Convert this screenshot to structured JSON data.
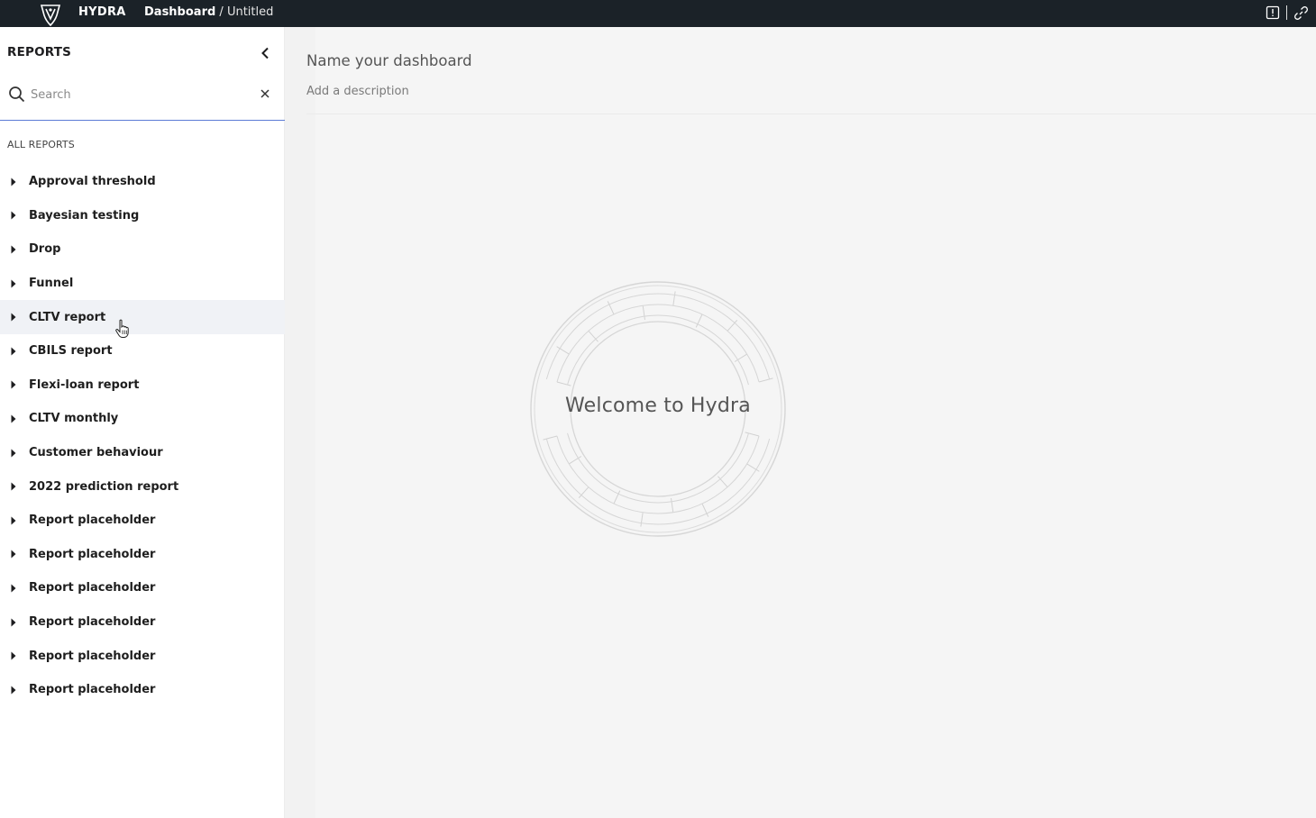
{
  "topbar": {
    "brand": "HYDRA",
    "breadcrumb_current": "Dashboard",
    "breadcrumb_separator": " / ",
    "breadcrumb_item": "Untitled",
    "icons": [
      "alert-icon",
      "link-icon"
    ]
  },
  "sidebar": {
    "title": "REPORTS",
    "search": {
      "placeholder": "Search",
      "value": ""
    },
    "section_label": "ALL REPORTS",
    "reports": [
      {
        "label": "Approval threshold"
      },
      {
        "label": "Bayesian testing"
      },
      {
        "label": "Drop"
      },
      {
        "label": "Funnel"
      },
      {
        "label": "CLTV report"
      },
      {
        "label": "CBILS report"
      },
      {
        "label": "Flexi-loan report"
      },
      {
        "label": "CLTV monthly"
      },
      {
        "label": "Customer behaviour"
      },
      {
        "label": "2022 prediction report"
      },
      {
        "label": "Report placeholder"
      },
      {
        "label": "Report placeholder"
      },
      {
        "label": "Report placeholder"
      },
      {
        "label": "Report placeholder"
      },
      {
        "label": "Report placeholder"
      },
      {
        "label": "Report placeholder"
      }
    ],
    "hovered_index": 4
  },
  "main": {
    "title_placeholder": "Name your dashboard",
    "description_placeholder": "Add a description",
    "welcome_text": "Welcome to Hydra"
  },
  "colors": {
    "topbar_bg": "#1b2228",
    "accent": "#5b7bd5",
    "hover_bg": "#f0f2f6",
    "main_bg": "#f5f5f5"
  }
}
